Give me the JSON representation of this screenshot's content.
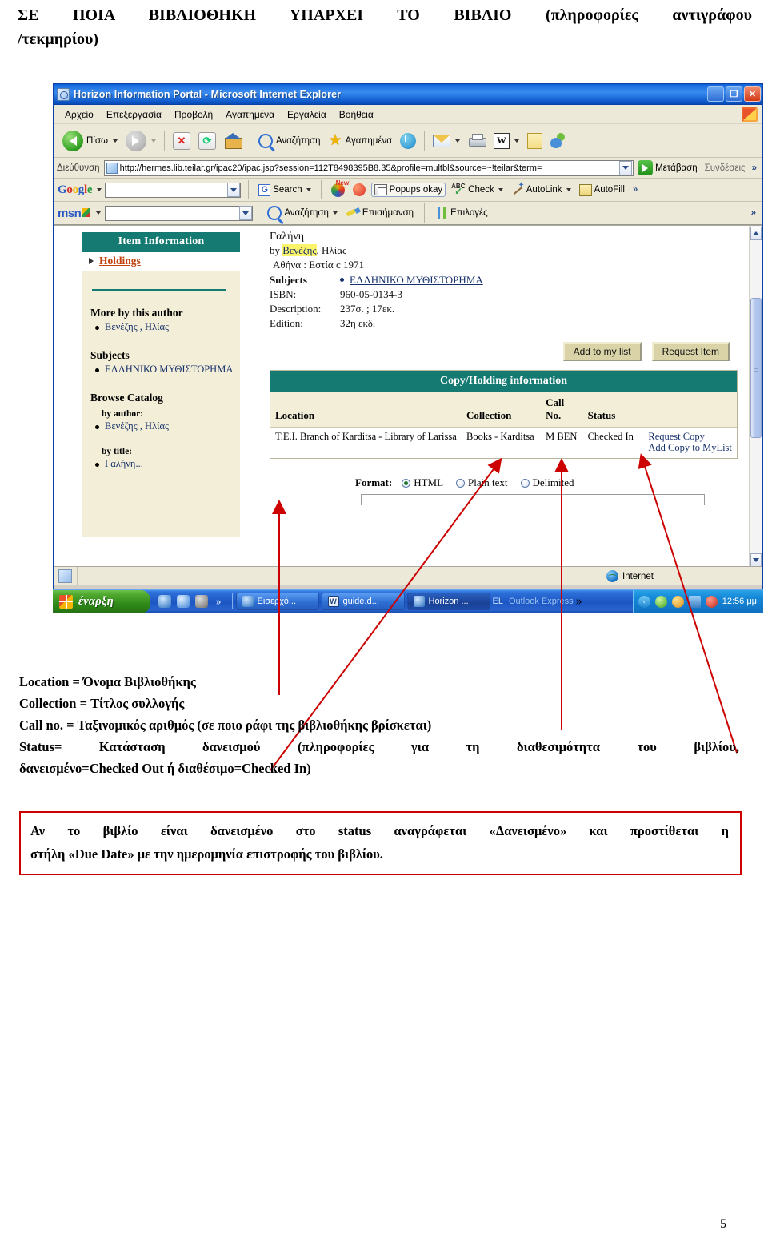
{
  "document": {
    "heading_line1": "ΣΕ ΠΟΙΑ ΒΙΒΛΙΟΘΗΚΗ ΥΠΑΡΧΕΙ ΤΟ ΒΙΒΛΙΟ (πληροφορίες αντιγράφου",
    "heading_line2": "/τεκμηρίου)",
    "page_number": "5"
  },
  "browser": {
    "title": "Horizon Information Portal - Microsoft Internet Explorer",
    "window_buttons": {
      "minimize": "_",
      "restore": "❐",
      "close": "✕"
    },
    "menu": [
      "Αρχείο",
      "Επεξεργασία",
      "Προβολή",
      "Αγαπημένα",
      "Εργαλεία",
      "Βοήθεια"
    ],
    "toolbar": {
      "back": "Πίσω",
      "search": "Αναζήτηση",
      "favorites": "Αγαπημένα"
    },
    "address": {
      "label": "Διεύθυνση",
      "url": "http://hermes.lib.teilar.gr/ipac20/ipac.jsp?session=112T8498395B8.35&profile=multbl&source=~!teilar&term=",
      "go": "Μετάβαση",
      "links": "Συνδέσεις",
      "overflow": "»"
    },
    "google_toolbar": {
      "logo": "Google",
      "search": "Search",
      "new_badge": "New!",
      "popups": "Popups okay",
      "check": "Check",
      "autolink": "AutoLink",
      "autofill": "AutoFill",
      "overflow": "»"
    },
    "msn_toolbar": {
      "logo": "msn",
      "search": "Αναζήτηση",
      "highlight": "Επισήμανση",
      "options": "Επιλογές",
      "overflow": "»"
    },
    "status": {
      "zone": "Internet"
    }
  },
  "page": {
    "sidebar": {
      "header": "Item Information",
      "holdings": "Holdings",
      "more_by_author": {
        "title": "More by this author",
        "items": [
          "Βενέζης , Ηλίας"
        ]
      },
      "subjects": {
        "title": "Subjects",
        "items": [
          "ΕΛΛΗΝΙΚΟ ΜΥΘΙΣΤΟΡΗΜΑ"
        ]
      },
      "browse_catalog": {
        "title": "Browse Catalog",
        "by_author_label": "by author:",
        "by_author": "Βενέζης , Ηλίας",
        "by_title_label": "by title:",
        "by_title": "Γαλήνη..."
      }
    },
    "record": {
      "title": "Γαλήνη",
      "by_prefix": "by",
      "author_highlight": "Βενέζης",
      "author_rest": ", Ηλίας",
      "imprint": "Αθήνα : Εστία c 1971",
      "fields": [
        {
          "name": "Subjects",
          "value": "ΕΛΛΗΝΙΚΟ ΜΥΘΙΣΤΟΡΗΜΑ",
          "bold": true,
          "link": true
        },
        {
          "name": "ISBN:",
          "value": "960-05-0134-3",
          "bold": false,
          "link": false
        },
        {
          "name": "Description:",
          "value": "237σ. ; 17εκ.",
          "bold": false,
          "link": false
        },
        {
          "name": "Edition:",
          "value": "32η εκδ.",
          "bold": false,
          "link": false
        }
      ],
      "buttons": [
        "Add to my list",
        "Request Item"
      ]
    },
    "copy_holding": {
      "header": "Copy/Holding information",
      "columns": [
        "Location",
        "Collection",
        "Call No.",
        "Status",
        ""
      ],
      "rows": [
        {
          "location": "T.E.I. Branch of Karditsa - Library of Larissa",
          "collection": "Books - Karditsa",
          "call_no": "M BEN",
          "status": "Checked In",
          "actions": [
            "Request Copy",
            "Add Copy to MyList"
          ]
        }
      ]
    },
    "format": {
      "label": "Format:",
      "options": [
        "HTML",
        "Plain text",
        "Delimited"
      ],
      "selected": "HTML"
    }
  },
  "taskbar": {
    "start": "έναρξη",
    "quicklaunch_overflow": "»",
    "tasks": [
      {
        "label": "Εισερχό...",
        "icon": "ie-icon",
        "active": false
      },
      {
        "label": "guide.d...",
        "icon": "word-icon",
        "active": false
      },
      {
        "label": "Horizon ...",
        "icon": "ie-icon",
        "active": true
      }
    ],
    "language": "EL",
    "outlook": "Outlook Express",
    "tray_overflow": "»",
    "clock": "12:56 μμ"
  },
  "annotations": {
    "legend": [
      "Location = Όνομα Βιβλιοθήκης",
      "Collection = Τίτλος συλλογής",
      "Call no. = Ταξινομικός αριθμός (σε ποιο ράφι της βιβλιοθήκης βρίσκεται)",
      "Status= Κατάσταση δανεισμού (πληροφορίες για τη διαθεσιμότητα του βιβλίου,",
      "δανεισμένο=Checked Out ή διαθέσιμο=Checked In)"
    ],
    "note_line1": "Αν το βιβλίο είναι δανεισμένο στο status αναγράφεται «Δανεισμένο» και προστίθεται η",
    "note_line2": "στήλη «Due Date» με την ημερομηνία επιστροφής του βιβλίου."
  },
  "colors": {
    "teal_header": "#157a72",
    "cream_panel": "#f2eed7",
    "link_blue": "#16306b",
    "holdings_red": "#c1440e",
    "arrow_red": "#cc0000",
    "note_border": "#cc0000",
    "highlight_yellow": "#fbf36a"
  }
}
